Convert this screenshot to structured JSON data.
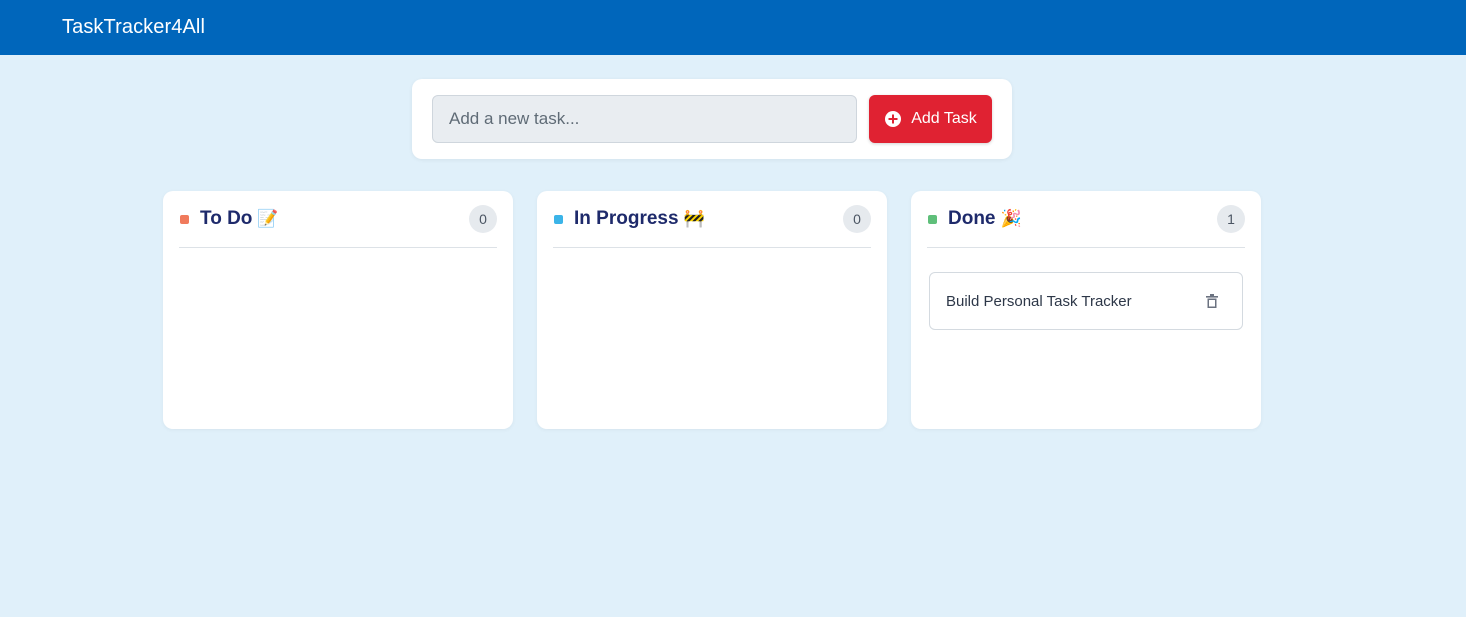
{
  "app": {
    "title": "TaskTracker4All"
  },
  "add_task": {
    "placeholder": "Add a new task...",
    "value": "",
    "button_label": "Add Task",
    "button_icon": "plus-circle-icon"
  },
  "columns": [
    {
      "title": "To Do",
      "emoji": "📝",
      "count": "0",
      "dot_color": "#f07a5c",
      "tasks": []
    },
    {
      "title": "In Progress",
      "emoji": "🚧",
      "count": "0",
      "dot_color": "#3bb4e8",
      "tasks": []
    },
    {
      "title": "Done",
      "emoji": "🎉",
      "count": "1",
      "dot_color": "#5fbf7a",
      "tasks": [
        {
          "text": "Build Personal Task Tracker",
          "action_icon": "trash-icon"
        }
      ]
    }
  ],
  "colors": {
    "header_bg": "#0066bb",
    "page_bg": "#e0f0fa",
    "button_bg": "#e02232",
    "title_text": "#1e2a6b"
  }
}
